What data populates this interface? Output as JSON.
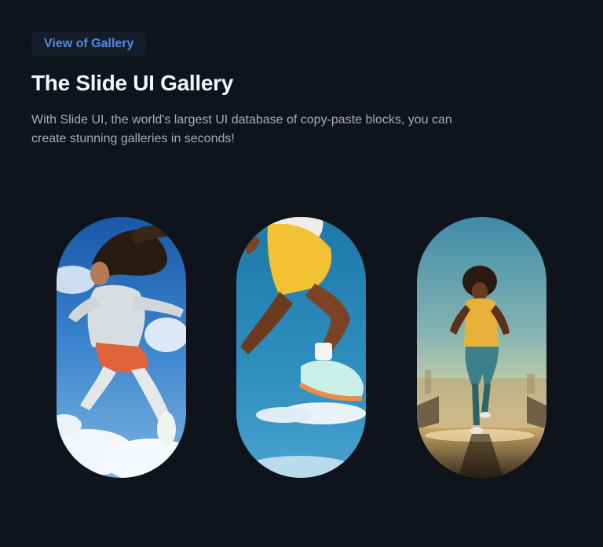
{
  "header": {
    "badge_label": "View of Gallery",
    "title": "The Slide UI Gallery",
    "description": "With Slide UI, the world's largest UI database of copy-paste blocks, you can create stunning galleries in seconds!"
  },
  "gallery": {
    "images": [
      {
        "name": "woman-jumping-sky-photo"
      },
      {
        "name": "runner-legs-jumping-photo"
      },
      {
        "name": "woman-running-sunset-photo"
      }
    ]
  }
}
